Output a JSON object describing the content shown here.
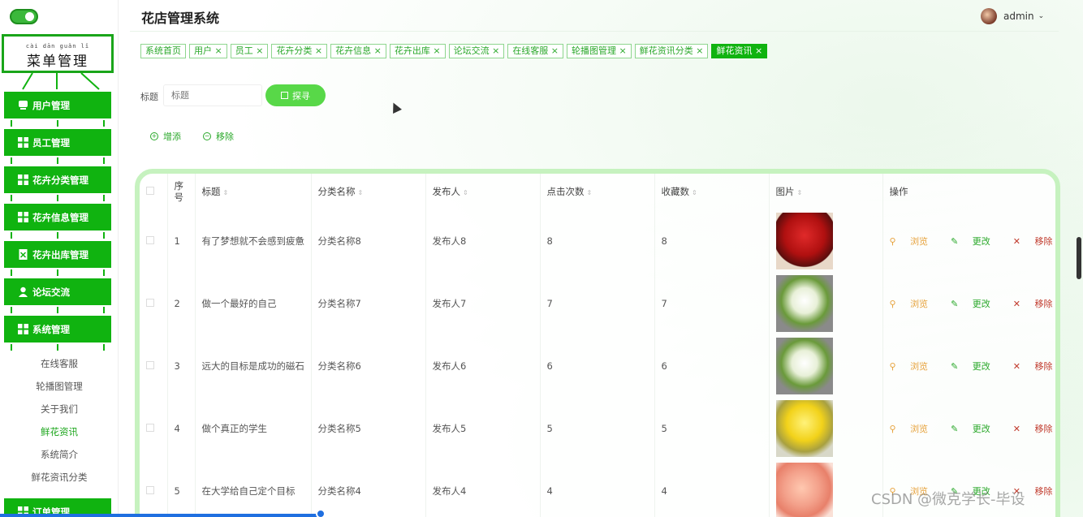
{
  "app_title": "花店管理系统",
  "user": {
    "name": "admin"
  },
  "sidebar": {
    "title_pinyin": "cài dān guǎn lǐ",
    "title": "菜单管理",
    "items": [
      {
        "label": "用户管理",
        "icon": "user-icon"
      },
      {
        "label": "员工管理",
        "icon": "grid-icon"
      },
      {
        "label": "花卉分类管理",
        "icon": "grid-icon"
      },
      {
        "label": "花卉信息管理",
        "icon": "grid-icon"
      },
      {
        "label": "花卉出库管理",
        "icon": "doc-icon"
      },
      {
        "label": "论坛交流",
        "icon": "person-icon"
      },
      {
        "label": "系统管理",
        "icon": "grid-icon"
      }
    ],
    "submenu": [
      "在线客服",
      "轮播图管理",
      "关于我们",
      "鲜花资讯",
      "系统简介",
      "鲜花资讯分类"
    ],
    "submenu_active": 3,
    "last_item": "订单管理"
  },
  "tabs": [
    {
      "label": "系统首页"
    },
    {
      "label": "用户 ×"
    },
    {
      "label": "员工 ×"
    },
    {
      "label": "花卉分类 ×"
    },
    {
      "label": "花卉信息 ×"
    },
    {
      "label": "花卉出库 ×"
    },
    {
      "label": "论坛交流 ×"
    },
    {
      "label": "在线客服 ×"
    },
    {
      "label": "轮播图管理 ×"
    },
    {
      "label": "鲜花资讯分类 ×"
    },
    {
      "label": "鲜花资讯 ×"
    }
  ],
  "tabs_active": 10,
  "search": {
    "label": "标题",
    "placeholder": "标题",
    "button": "探寻"
  },
  "actions": {
    "add": "增添",
    "remove": "移除"
  },
  "table": {
    "columns": [
      "序号",
      "标题",
      "分类名称",
      "发布人",
      "点击次数",
      "收藏数",
      "图片",
      "操作"
    ],
    "rows": [
      {
        "no": "1",
        "title": "有了梦想就不会感到疲惫",
        "category": "分类名称8",
        "author": "发布人8",
        "clicks": "8",
        "favs": "8",
        "pic": "red-rose-bouquet"
      },
      {
        "no": "2",
        "title": "做一个最好的自己",
        "category": "分类名称7",
        "author": "发布人7",
        "clicks": "7",
        "favs": "7",
        "pic": "lily-bouquet"
      },
      {
        "no": "3",
        "title": "远大的目标是成功的磁石",
        "category": "分类名称6",
        "author": "发布人6",
        "clicks": "6",
        "favs": "6",
        "pic": "lily-bouquet"
      },
      {
        "no": "4",
        "title": "做个真正的学生",
        "category": "分类名称5",
        "author": "发布人5",
        "clicks": "5",
        "favs": "5",
        "pic": "yellow-bouquet"
      },
      {
        "no": "5",
        "title": "在大学给自己定个目标",
        "category": "分类名称4",
        "author": "发布人4",
        "clicks": "4",
        "favs": "4",
        "pic": "peach-rose-bouquet"
      }
    ],
    "ops": {
      "view": "浏览",
      "edit": "更改",
      "delete": "移除"
    }
  },
  "watermark": "CSDN @微克学长-毕设",
  "colors": {
    "brand": "#10b310",
    "accent": "#58d848",
    "view": "#e6a23c",
    "delete": "#c0392b"
  }
}
